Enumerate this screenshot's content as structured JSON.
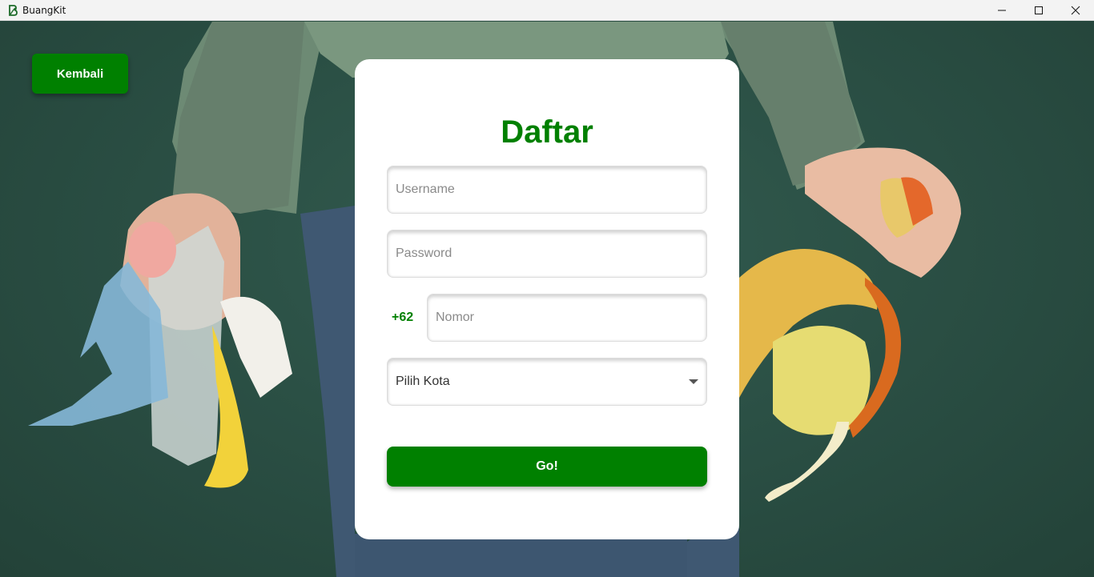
{
  "window": {
    "title": "BuangKit"
  },
  "back_button": {
    "label": "Kembali"
  },
  "form": {
    "title": "Daftar",
    "username": {
      "placeholder": "Username",
      "value": ""
    },
    "password": {
      "placeholder": "Password",
      "value": ""
    },
    "phone": {
      "prefix": "+62",
      "placeholder": "Nomor",
      "value": ""
    },
    "city": {
      "selected": "Pilih Kota"
    },
    "submit_label": "Go!"
  },
  "colors": {
    "primary": "#008000",
    "background": "#2a4d42",
    "card": "#ffffff"
  }
}
